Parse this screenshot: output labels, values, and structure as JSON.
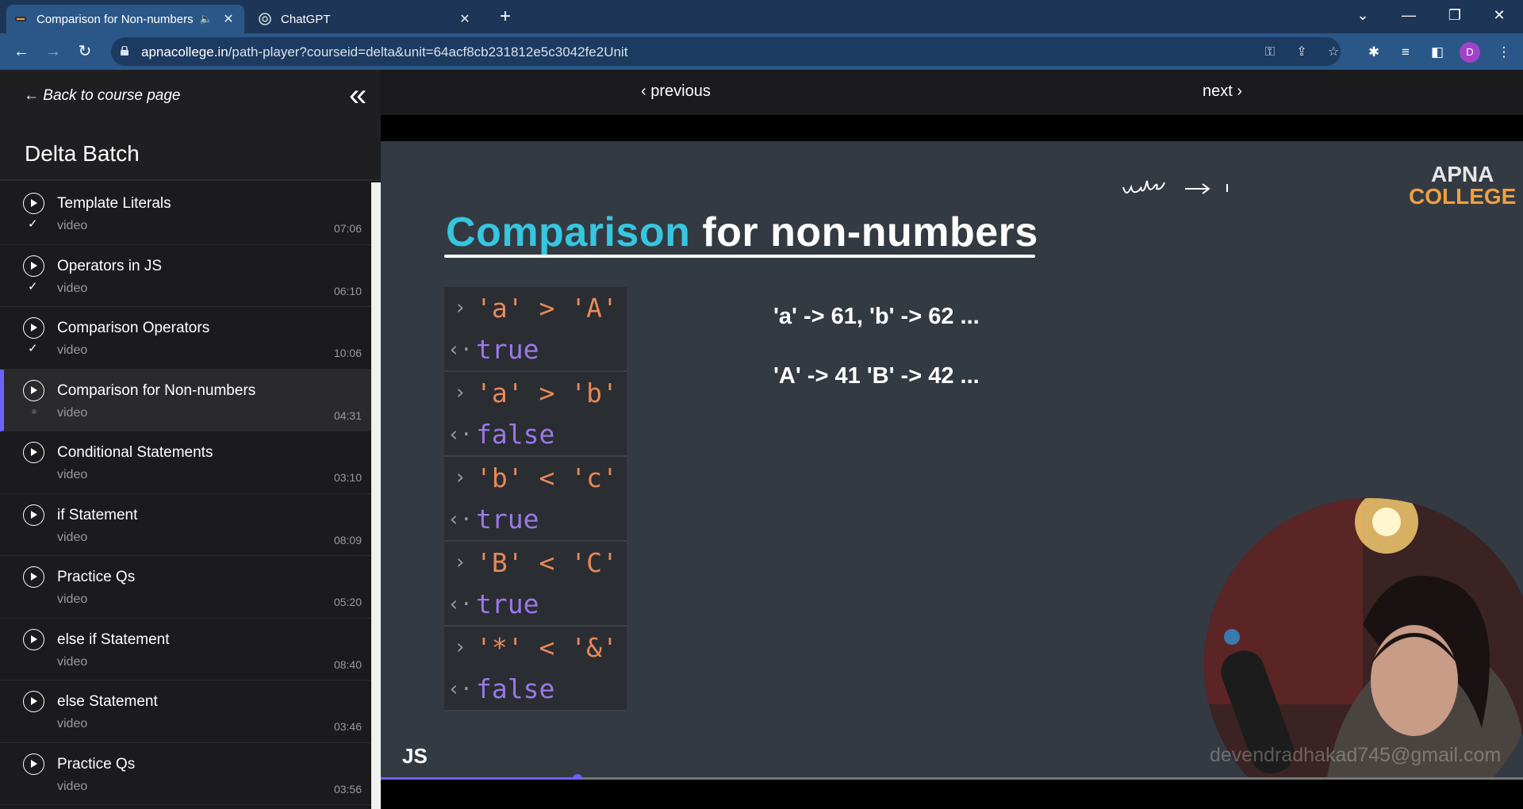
{
  "browser": {
    "tabs": [
      {
        "title": "Comparison for Non-numbers",
        "active": true,
        "audio": true
      },
      {
        "title": "ChatGPT",
        "active": false,
        "audio": false
      }
    ],
    "url_host": "apnacollege.in",
    "url_path": "/path-player?courseid=delta&unit=64acf8cb231812e5c3042fe2Unit",
    "profile_initial": "D"
  },
  "sidebar": {
    "back_label": "Back to course page",
    "course_title": "Delta Batch",
    "lessons": [
      {
        "title": "Template Literals",
        "type": "video",
        "duration": "07:06",
        "status": "done"
      },
      {
        "title": "Operators in JS",
        "type": "video",
        "duration": "06:10",
        "status": "done"
      },
      {
        "title": "Comparison Operators",
        "type": "video",
        "duration": "10:06",
        "status": "done"
      },
      {
        "title": "Comparison for Non-numbers",
        "type": "video",
        "duration": "04:31",
        "status": "current"
      },
      {
        "title": "Conditional Statements",
        "type": "video",
        "duration": "03:10",
        "status": "todo"
      },
      {
        "title": "if Statement",
        "type": "video",
        "duration": "08:09",
        "status": "todo"
      },
      {
        "title": "Practice Qs",
        "type": "video",
        "duration": "05:20",
        "status": "todo"
      },
      {
        "title": "else if Statement",
        "type": "video",
        "duration": "08:40",
        "status": "todo"
      },
      {
        "title": "else Statement",
        "type": "video",
        "duration": "03:46",
        "status": "todo"
      },
      {
        "title": "Practice Qs",
        "type": "video",
        "duration": "03:56",
        "status": "todo"
      }
    ]
  },
  "player": {
    "prev_label": "previous",
    "next_label": "next",
    "progress_fraction": 0.172,
    "accent_color": "#6c63ff"
  },
  "slide": {
    "title_highlight": "Comparison",
    "title_rest": " for non-numbers",
    "console": [
      {
        "input": "'a' > 'A'",
        "result": "true"
      },
      {
        "input": "'a' > 'b'",
        "result": "false"
      },
      {
        "input": "'b' < 'c'",
        "result": "true"
      },
      {
        "input": "'B' < 'C'",
        "result": "true"
      },
      {
        "input": "'*' < '&'",
        "result": "false"
      }
    ],
    "ascii_lower": "'a' -> 61, 'b' -> 62 ...",
    "ascii_upper": "'A' -> 41 'B' -> 42 ...",
    "logo_line1": "APNA",
    "logo_line2": "COLLEGE",
    "handwriting": "value → ı",
    "label": "JS",
    "watermark": "devendradhakad745@gmail.com"
  }
}
